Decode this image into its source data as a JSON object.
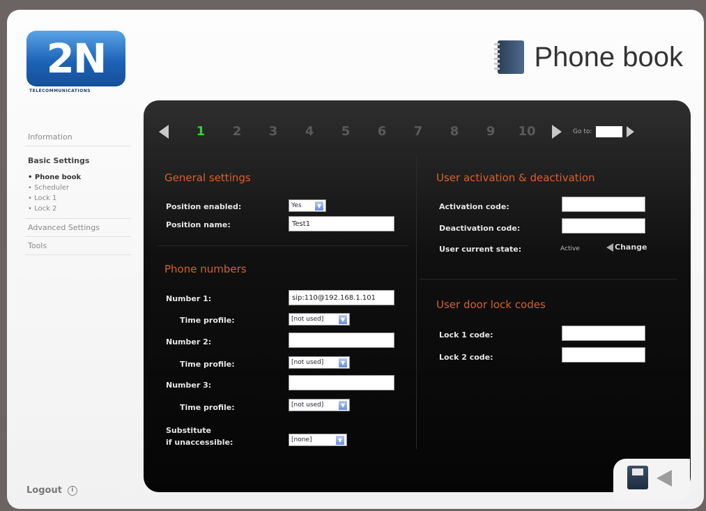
{
  "header": {
    "logo_text": "2N",
    "logo_sub": "TELECOMMUNICATIONS",
    "page_title": "Phone book"
  },
  "sidebar": {
    "items": [
      {
        "label": "Information"
      },
      {
        "label": "Basic Settings"
      },
      {
        "label": "Advanced Settings"
      },
      {
        "label": "Tools"
      }
    ],
    "sub_items": [
      {
        "label": "Phone book",
        "active": true
      },
      {
        "label": "Scheduler",
        "active": false
      },
      {
        "label": "Lock 1",
        "active": false
      },
      {
        "label": "Lock 2",
        "active": false
      }
    ],
    "logout_label": "Logout"
  },
  "pager": {
    "pages": [
      "1",
      "2",
      "3",
      "4",
      "5",
      "6",
      "7",
      "8",
      "9",
      "10"
    ],
    "active_page": "1",
    "goto_label": "Go to:"
  },
  "general_settings": {
    "title": "General settings",
    "position_enabled_label": "Position enabled:",
    "position_enabled_value": "Yes",
    "position_name_label": "Position name:",
    "position_name_value": "Test1"
  },
  "phone_numbers": {
    "title": "Phone numbers",
    "number1_label": "Number 1:",
    "number1_value": "sip:110@192.168.1.101",
    "number2_label": "Number 2:",
    "number2_value": "",
    "number3_label": "Number 3:",
    "number3_value": "",
    "time_profile_label": "Time profile:",
    "time_profile_value": "[not used]",
    "substitute_label_1": "Substitute",
    "substitute_label_2": "if unaccessible:",
    "substitute_value": "[none]"
  },
  "activation": {
    "title": "User activation & deactivation",
    "activation_code_label": "Activation code:",
    "deactivation_code_label": "Deactivation code:",
    "current_state_label": "User current state:",
    "current_state_value": "Active",
    "change_label": "Change"
  },
  "door_lock": {
    "title": "User door lock codes",
    "lock1_label": "Lock 1 code:",
    "lock2_label": "Lock 2 code:"
  },
  "colors": {
    "section_title": "#d9602a",
    "active_page": "#2fd12f",
    "logo_blue": "#1d63b8"
  }
}
